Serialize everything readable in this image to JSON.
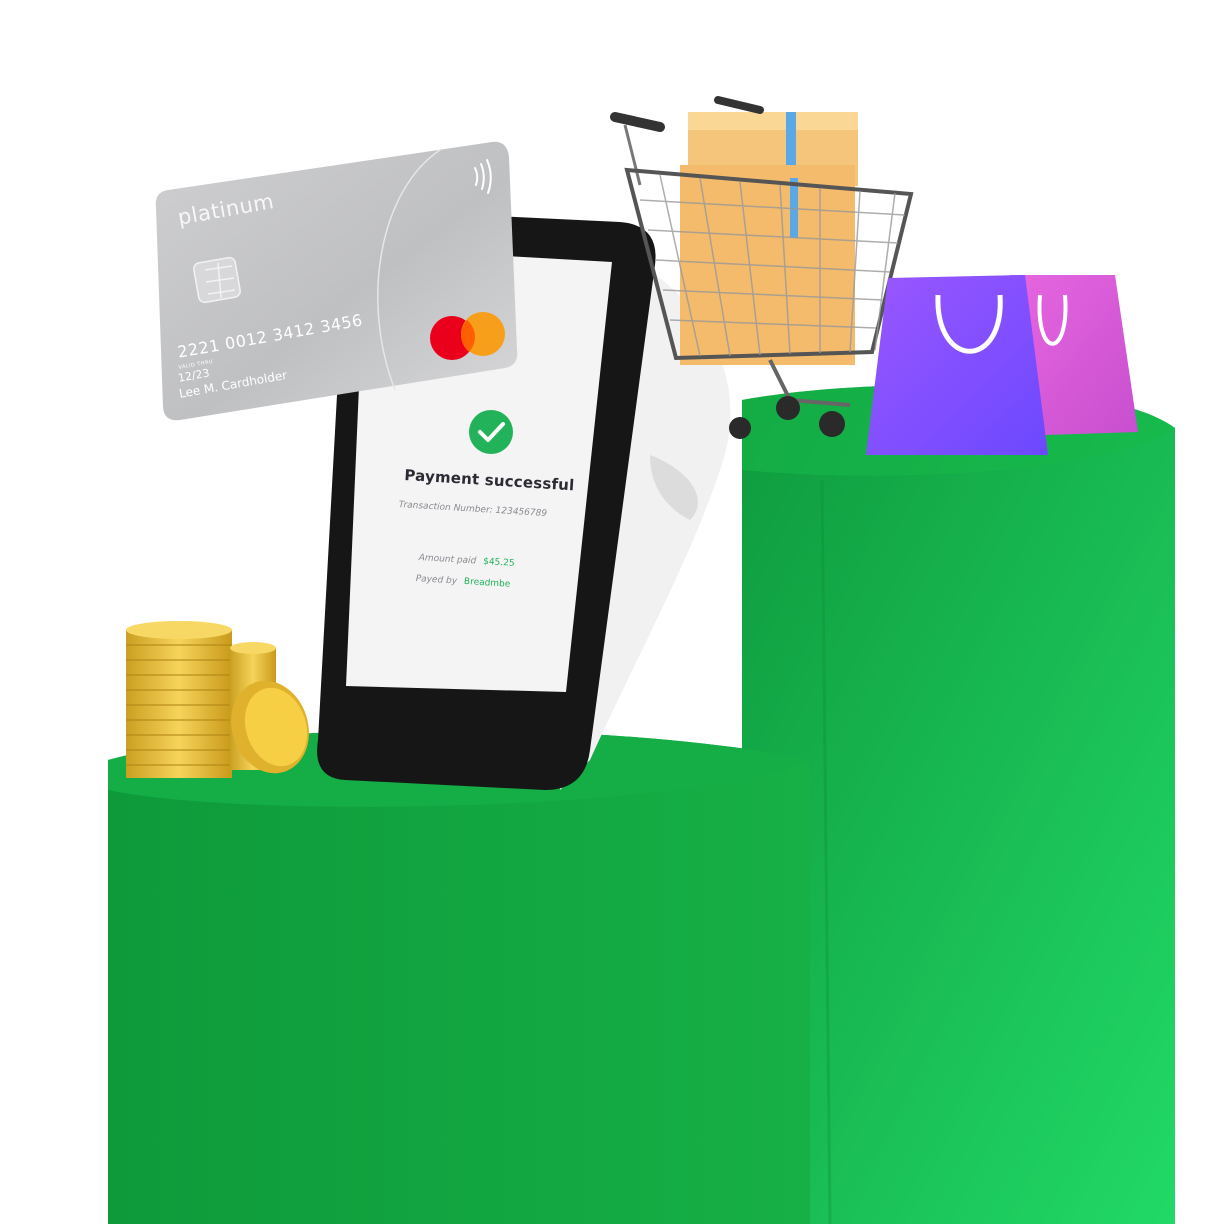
{
  "payment_screen": {
    "status_title": "Payment successful",
    "transaction_label": "Transaction Number",
    "transaction_number": "123456789",
    "amount_label": "Amount paid",
    "amount_value": "$45.25",
    "payer_label": "Payed by",
    "payer_value": "Breadmbe",
    "icons": [
      "check-icon"
    ]
  },
  "credit_card": {
    "brand_label": "platinum",
    "number": "2221 0012 3412 3456",
    "valid_thru_label": "VALID THRU",
    "expiry": "12/23",
    "holder": "Lee M. Cardholder",
    "icons": [
      "contactless-icon",
      "chip-icon",
      "mastercard-logo"
    ]
  },
  "colors": {
    "pedestal_green": "#17b24a",
    "success_green": "#22b35a",
    "card_silver": "#c4c4c6",
    "bag_purple": "#7d4dff",
    "bag_pink": "#e35ddb",
    "coin_gold": "#f2c43a",
    "box_tan": "#f7c47a"
  }
}
